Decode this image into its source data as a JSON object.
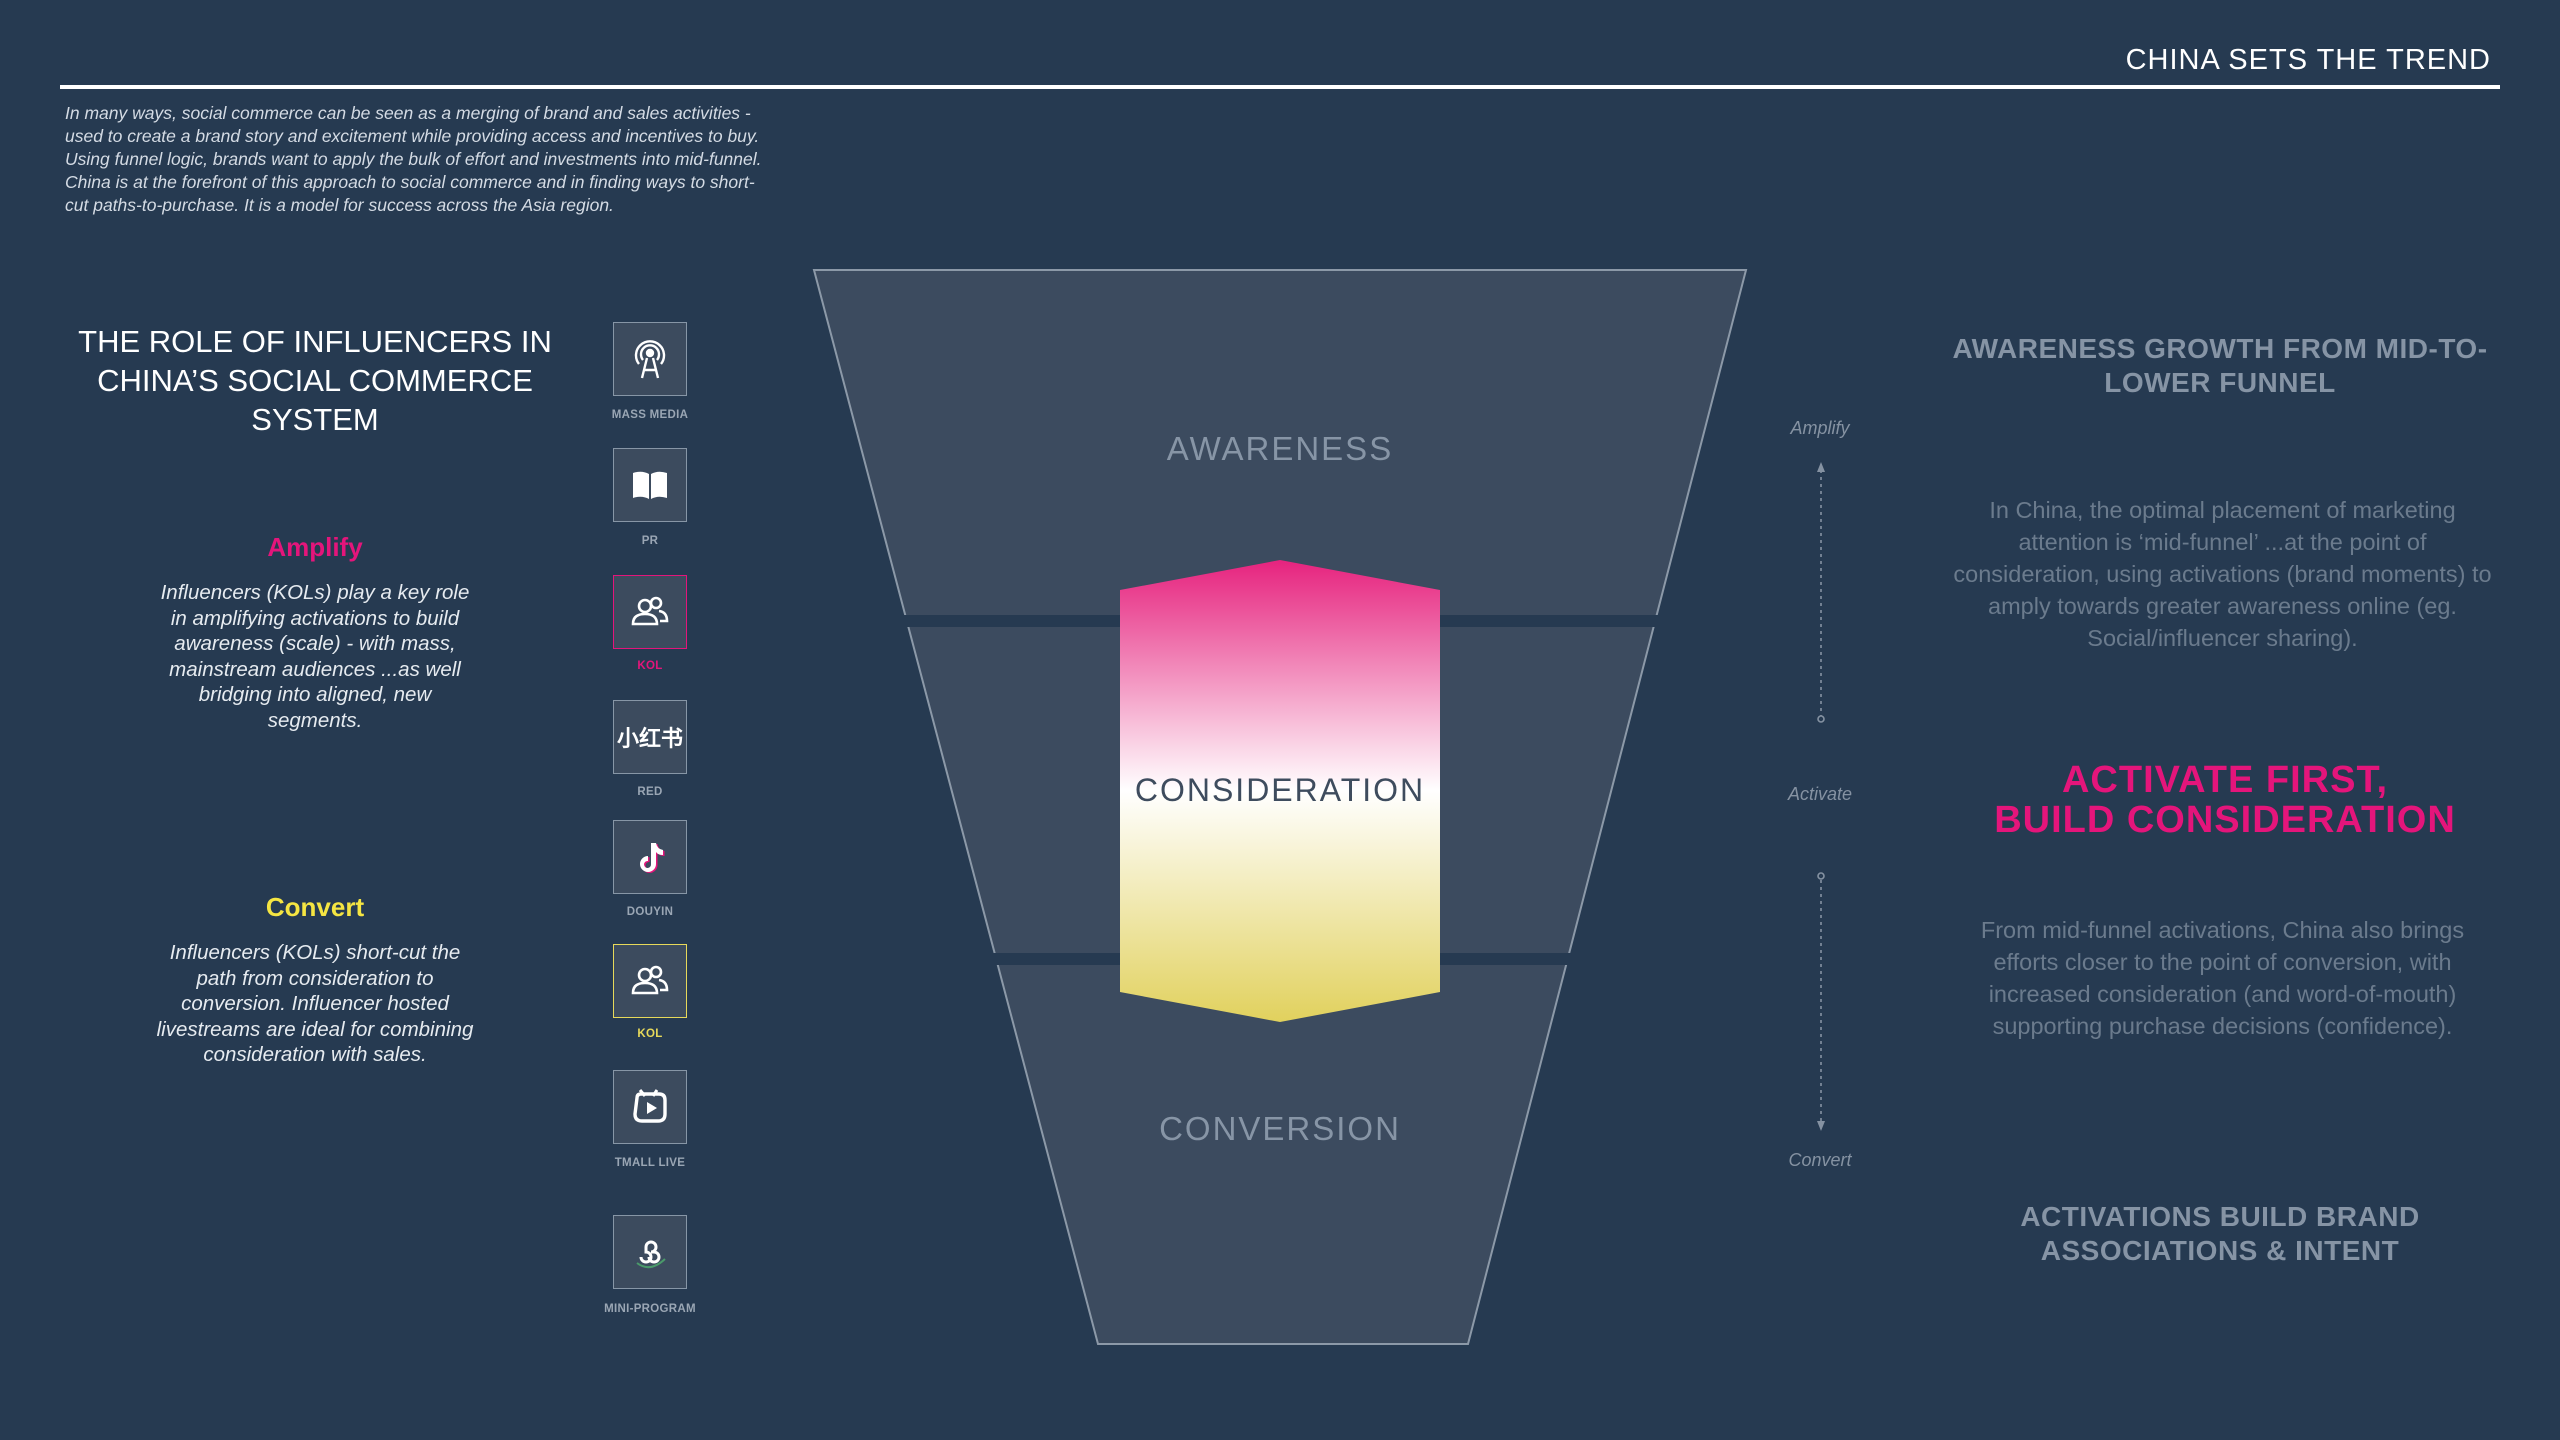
{
  "header": {
    "title": "CHINA SETS THE TREND"
  },
  "intro": "In many ways, social commerce can be seen as a merging of brand and sales activities - used to create a brand story and excitement while providing access and incentives to buy. Using funnel logic, brands want to apply the bulk of effort and investments into mid-funnel. China is at the forefront of this approach to social commerce and in finding ways to short-cut paths-to-purchase. It is a model for success across the Asia region.",
  "left": {
    "title": "THE ROLE OF INFLUENCERS IN CHINA’S SOCIAL COMMERCE SYSTEM",
    "amplify": {
      "heading": "Amplify",
      "body": "Influencers (KOLs) play a key role in amplifying activations to build awareness (scale) - with mass, mainstream audiences ...as well bridging into aligned, new segments."
    },
    "convert": {
      "heading": "Convert",
      "body": "Influencers (KOLs) short-cut the path from consideration to conversion. Influencer hosted livestreams are ideal for combining consideration with sales."
    }
  },
  "channels": [
    {
      "label": "MASS MEDIA",
      "icon": "broadcast-tower-icon"
    },
    {
      "label": "PR",
      "icon": "open-book-icon"
    },
    {
      "label": "KOL",
      "icon": "people-icon",
      "accent": "#e4157b"
    },
    {
      "label": "RED",
      "icon": "xiaohongshu-icon",
      "glyph": "小红书"
    },
    {
      "label": "DOUYIN",
      "icon": "douyin-note-icon"
    },
    {
      "label": "KOL",
      "icon": "people-icon",
      "accent": "#e7d95a"
    },
    {
      "label": "TMALL LIVE",
      "icon": "tmall-live-icon"
    },
    {
      "label": "MINI-PROGRAM",
      "icon": "mini-program-icon"
    }
  ],
  "funnel": {
    "stages": [
      "AWARENESS",
      "CONSIDERATION",
      "CONVERSION"
    ],
    "gradient_colors": [
      "#e6237e",
      "#ffffff",
      "#e1d15d"
    ]
  },
  "flow": {
    "amplify": "Amplify",
    "activate": "Activate",
    "convert": "Convert"
  },
  "right": {
    "heading1": "AWARENESS GROWTH FROM MID-TO-LOWER FUNNEL",
    "body1": "In China, the optimal placement of marketing attention is ‘mid-funnel’ ...at the point of consideration, using activations (brand moments) to amply towards greater awareness online (eg. Social/influencer sharing).",
    "activate_line1": "ACTIVATE FIRST,",
    "activate_line2": "BUILD CONSIDERATION",
    "body2": "From mid-funnel activations, China also brings efforts closer to the point of conversion, with increased consideration (and word-of-mouth) supporting purchase decisions (confidence).",
    "heading2": "ACTIVATIONS BUILD BRAND ASSOCIATIONS & INTENT"
  },
  "colors": {
    "background": "#263a51",
    "pink": "#e4157b",
    "yellow": "#f5e542"
  }
}
